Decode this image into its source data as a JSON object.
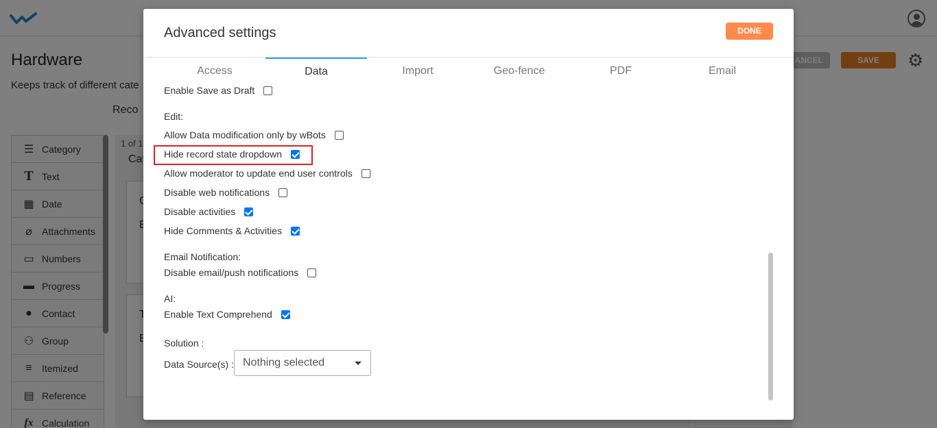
{
  "app": {
    "page_title": "Hardware",
    "page_subtitle": "Keeps track of different cate",
    "records_tab": "Reco",
    "cancel_label": "ANCEL",
    "save_label": "SAVE",
    "palette": [
      {
        "label": "Category",
        "icon": "list-icon",
        "glyph": "☰"
      },
      {
        "label": "Text",
        "icon": "text-icon",
        "glyph": "T"
      },
      {
        "label": "Date",
        "icon": "calendar-icon",
        "glyph": "▦"
      },
      {
        "label": "Attachments",
        "icon": "paperclip-icon",
        "glyph": "⌀"
      },
      {
        "label": "Numbers",
        "icon": "numbers-icon",
        "glyph": "▭"
      },
      {
        "label": "Progress",
        "icon": "progress-icon",
        "glyph": "▬"
      },
      {
        "label": "Contact",
        "icon": "contact-icon",
        "glyph": "●"
      },
      {
        "label": "Group",
        "icon": "group-icon",
        "glyph": "⚇"
      },
      {
        "label": "Itemized",
        "icon": "itemized-icon",
        "glyph": "≡"
      },
      {
        "label": "Reference",
        "icon": "reference-icon",
        "glyph": "▤"
      },
      {
        "label": "Calculation",
        "icon": "function-icon",
        "glyph": "fx"
      }
    ],
    "canvas_count": "1 of 1",
    "canvas_header": "Cat",
    "card1_title": "C",
    "card1_body": "E",
    "card2_title": "T",
    "card2_body": "E"
  },
  "modal": {
    "title": "Advanced settings",
    "done_label": "DONE",
    "tabs": [
      {
        "label": "Access",
        "active": false
      },
      {
        "label": "Data",
        "active": true
      },
      {
        "label": "Import",
        "active": false
      },
      {
        "label": "Geo-fence",
        "active": false
      },
      {
        "label": "PDF",
        "active": false
      },
      {
        "label": "Email",
        "active": false
      }
    ],
    "enable_save_as_draft": {
      "label": "Enable Save as Draft",
      "checked": false
    },
    "edit_heading": "Edit:",
    "edit_options": [
      {
        "label": "Allow Data modification only by wBots",
        "checked": false
      },
      {
        "label": "Hide record state dropdown",
        "checked": true
      },
      {
        "label": "Allow moderator to update end user controls",
        "checked": false
      },
      {
        "label": "Disable web notifications",
        "checked": false
      },
      {
        "label": "Disable activities",
        "checked": true
      },
      {
        "label": "Hide Comments & Activities",
        "checked": true
      }
    ],
    "email_heading": "Email Notification:",
    "email_options": [
      {
        "label": "Disable email/push notifications",
        "checked": false
      }
    ],
    "ai_heading": "AI:",
    "ai_options": [
      {
        "label": "Enable Text Comprehend",
        "checked": true
      }
    ],
    "solution_heading": "Solution :",
    "data_source_label": "Data Source(s) :",
    "data_source_value": "Nothing selected"
  },
  "colors": {
    "accent_tab": "#29a8e0",
    "done_button": "#ff8a4c",
    "save_button": "#e67e22",
    "checkbox_on": "#0075ff",
    "highlight": "#e02020"
  }
}
